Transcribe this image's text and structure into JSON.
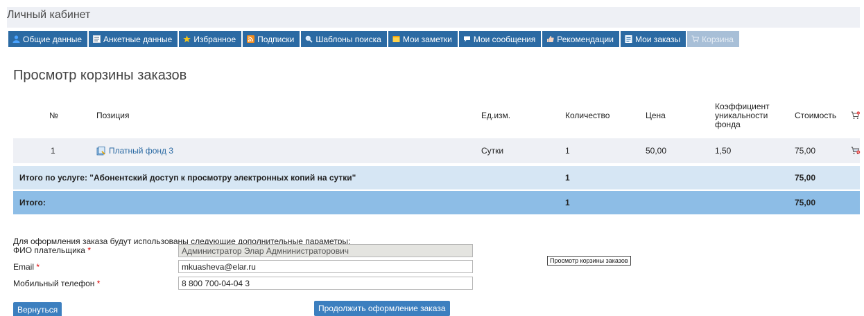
{
  "header": {
    "title": "Личный кабинет"
  },
  "nav": {
    "tabs": [
      {
        "label": "Общие данные",
        "icon": "user-icon"
      },
      {
        "label": "Анкетные данные",
        "icon": "form-icon"
      },
      {
        "label": "Избранное",
        "icon": "star-icon"
      },
      {
        "label": "Подписки",
        "icon": "rss-icon"
      },
      {
        "label": "Шаблоны поиска",
        "icon": "search-icon"
      },
      {
        "label": "Мои заметки",
        "icon": "note-icon"
      },
      {
        "label": "Мои сообщения",
        "icon": "message-icon"
      },
      {
        "label": "Рекомендации",
        "icon": "thumb-icon"
      },
      {
        "label": "Мои заказы",
        "icon": "orders-icon"
      },
      {
        "label": "Корзина",
        "icon": "cart-icon"
      }
    ],
    "active_tab": "Корзина"
  },
  "page": {
    "title": "Просмотр корзины заказов"
  },
  "table": {
    "headers": {
      "num": "№",
      "position": "Позиция",
      "unit": "Ед.изм.",
      "qty": "Количество",
      "price": "Цена",
      "coef_l1": "Коэффициент",
      "coef_l2": "уникальности",
      "coef_l3": "фонда",
      "cost": "Стоимость"
    },
    "rows": [
      {
        "num": "1",
        "position": "Платный фонд 3",
        "unit": "Сутки",
        "qty": "1",
        "price": "50,00",
        "coef": "1,50",
        "cost": "75,00"
      }
    ],
    "subtotal": {
      "label": "Итого по услуге: \"Абонентский доступ к просмотру электронных копий на сутки\"",
      "qty": "1",
      "cost": "75,00"
    },
    "total": {
      "label": "Итого:",
      "qty": "1",
      "cost": "75,00"
    }
  },
  "form": {
    "intro": "Для оформления заказа будут использованы следующие дополнительные параметры:",
    "required_mark": "*",
    "fields": [
      {
        "label": "ФИО плательщика",
        "value": "Администратор Элар Адмниниcтраторович",
        "readonly": true
      },
      {
        "label": "Email",
        "value": "mkuasheva@elar.ru",
        "readonly": false
      },
      {
        "label": "Мобильный телефон",
        "value": "8 800 700-04-04 3",
        "readonly": false
      }
    ]
  },
  "buttons": {
    "back": "Вернуться",
    "continue": "Продолжить оформление заказа"
  },
  "tooltip": "Просмотр корзины заказов",
  "colors": {
    "nav_bg": "#2b6aa3",
    "nav_active": "#a8bfd7",
    "row_alt": "#eef0f5",
    "subtotal_bg": "#d6e6f4",
    "total_bg": "#8dbde6",
    "link": "#2b6aa3",
    "button": "#3c7fbf",
    "required": "#dd0000"
  }
}
